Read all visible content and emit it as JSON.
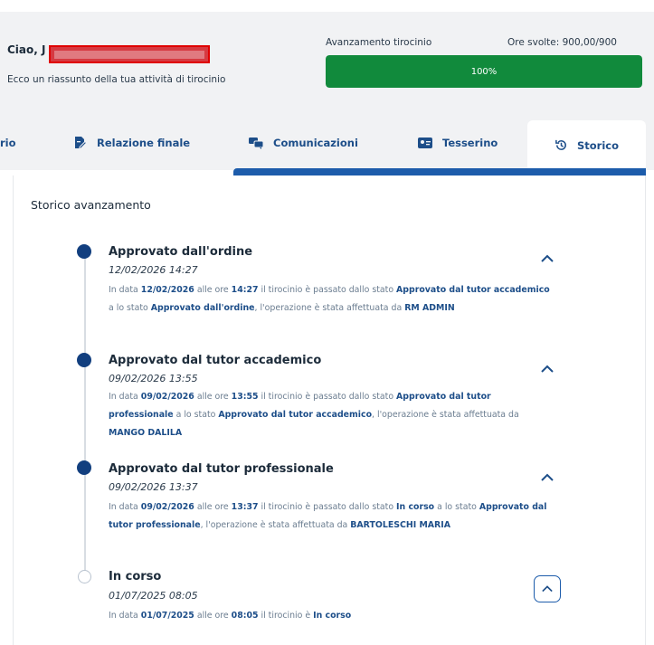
{
  "header": {
    "greeting": "Ciao, J",
    "subtitle": "Ecco un riassunto della tua attività di tirocinio",
    "progress_label": "Avanzamento tirocinio",
    "hours_label": "Ore svolte: 900,00/900",
    "progress_text": "100%",
    "progress_fraction": 1.0,
    "colors": {
      "progress_fill": "#118a3c",
      "redaction": "#d63a41"
    }
  },
  "tabs": [
    {
      "label": "rio",
      "icon": ""
    },
    {
      "label": "Relazione finale",
      "icon": "document-edit-icon"
    },
    {
      "label": "Comunicazioni",
      "icon": "chat-bubbles-icon"
    },
    {
      "label": "Tesserino",
      "icon": "id-card-icon"
    },
    {
      "label": "Storico",
      "icon": "history-icon",
      "active": true
    }
  ],
  "section": {
    "title": "Storico avanzamento"
  },
  "entries": [
    {
      "title": "Approvato dall'ordine",
      "date": "12/02/2026 14:27",
      "desc": [
        {
          "t": "In data ",
          "b": false
        },
        {
          "t": "12/02/2026",
          "b": true
        },
        {
          "t": " alle ore ",
          "b": false
        },
        {
          "t": "14:27",
          "b": true
        },
        {
          "t": " il tirocinio è passato dallo stato ",
          "b": false
        },
        {
          "t": "Approvato dal tutor accademico",
          "b": true
        },
        {
          "t": " a lo stato ",
          "b": false
        },
        {
          "t": "Approvato dall'ordine",
          "b": true
        },
        {
          "t": ", l'operazione è stata affettuata da ",
          "b": false
        },
        {
          "t": "RM ADMIN",
          "b": true
        }
      ],
      "expanded": true
    },
    {
      "title": "Approvato dal tutor accademico",
      "date": "09/02/2026 13:55",
      "desc": [
        {
          "t": "In data ",
          "b": false
        },
        {
          "t": "09/02/2026",
          "b": true
        },
        {
          "t": " alle ore ",
          "b": false
        },
        {
          "t": "13:55",
          "b": true
        },
        {
          "t": " il tirocinio è passato dallo stato ",
          "b": false
        },
        {
          "t": "Approvato dal tutor professionale",
          "b": true
        },
        {
          "t": " a lo stato ",
          "b": false
        },
        {
          "t": "Approvato dal tutor accademico",
          "b": true
        },
        {
          "t": ", l'operazione è stata affettuata da ",
          "b": false
        },
        {
          "t": "MANGO DALILA",
          "b": true
        }
      ],
      "expanded": true
    },
    {
      "title": "Approvato dal tutor professionale",
      "date": "09/02/2026 13:37",
      "desc": [
        {
          "t": "In data ",
          "b": false
        },
        {
          "t": "09/02/2026",
          "b": true
        },
        {
          "t": " alle ore ",
          "b": false
        },
        {
          "t": "13:37",
          "b": true
        },
        {
          "t": " il tirocinio è passato dallo stato ",
          "b": false
        },
        {
          "t": "In corso",
          "b": true
        },
        {
          "t": " a lo stato ",
          "b": false
        },
        {
          "t": "Approvato dal tutor professionale",
          "b": true
        },
        {
          "t": ", l'operazione è stata affettuata da ",
          "b": false
        },
        {
          "t": "BARTOLESCHI MARIA",
          "b": true
        }
      ],
      "expanded": true
    },
    {
      "title": "In corso",
      "date": "01/07/2025 08:05",
      "desc": [
        {
          "t": "In data ",
          "b": false
        },
        {
          "t": "01/07/2025",
          "b": true
        },
        {
          "t": " alle ore ",
          "b": false
        },
        {
          "t": "08:05",
          "b": true
        },
        {
          "t": " il tirocinio è ",
          "b": false
        },
        {
          "t": "In corso",
          "b": true
        }
      ],
      "expanded": true
    }
  ]
}
